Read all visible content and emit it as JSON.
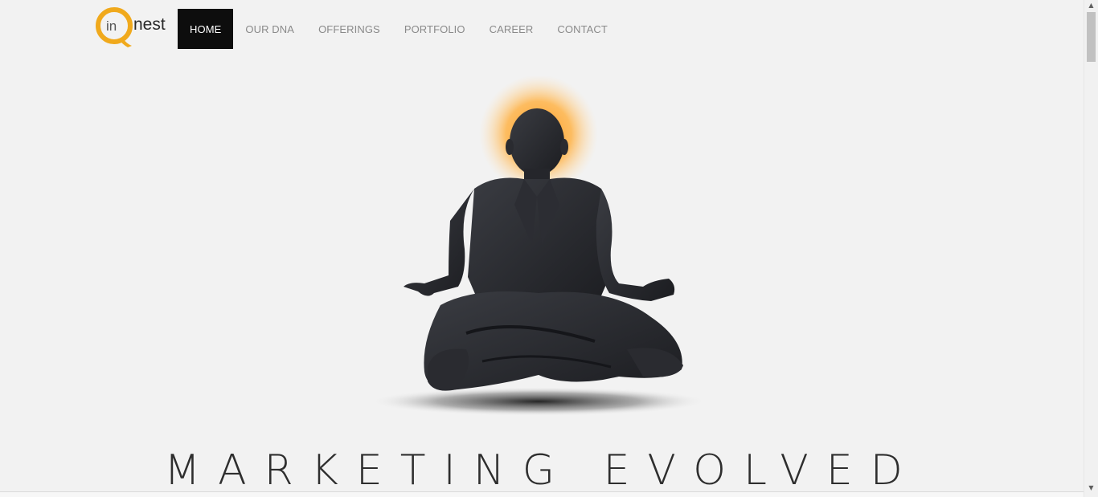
{
  "brand": {
    "logo_prefix": "in",
    "logo_suffix": "nest",
    "accent_color": "#f0a91c"
  },
  "nav": {
    "items": [
      {
        "label": "HOME",
        "active": true
      },
      {
        "label": "OUR DNA",
        "active": false
      },
      {
        "label": "OFFERINGS",
        "active": false
      },
      {
        "label": "PORTFOLIO",
        "active": false
      },
      {
        "label": "CAREER",
        "active": false
      },
      {
        "label": "CONTACT",
        "active": false
      }
    ]
  },
  "hero": {
    "image": "meditating-businessman-statue",
    "halo_color": "#ffb347",
    "tagline": "MARKETING EVOLVED"
  },
  "scrollbar": {
    "up_icon": "▲",
    "down_icon": "▼"
  }
}
